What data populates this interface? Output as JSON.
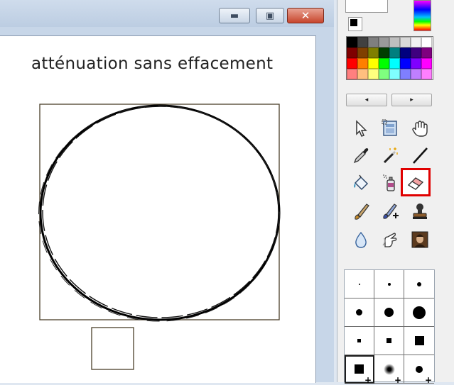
{
  "window": {
    "buttons": {
      "minimize": "minimize-icon",
      "maximize": "maximize-icon",
      "close": "close-icon"
    }
  },
  "canvas": {
    "text": "atténuation sans effacement"
  },
  "palette": {
    "colors": [
      "#000000",
      "#404040",
      "#7f7f7f",
      "#9a9a9a",
      "#bfbfbf",
      "#d9d9d9",
      "#f2f2f2",
      "#ffffff",
      "#7f0000",
      "#7f3f00",
      "#7f7f00",
      "#003f00",
      "#007f7f",
      "#00007f",
      "#3f007f",
      "#7f007f",
      "#ff0000",
      "#ff7f00",
      "#ffff00",
      "#00ff00",
      "#00ffff",
      "#0000ff",
      "#7f00ff",
      "#ff00ff",
      "#ff7f7f",
      "#ffbf7f",
      "#ffff7f",
      "#7fff7f",
      "#7fffff",
      "#7f7fff",
      "#bf7fff",
      "#ff7fff"
    ],
    "nav": {
      "left": "◂",
      "right": "▸"
    }
  },
  "tools": [
    {
      "name": "select-arrow-icon"
    },
    {
      "name": "image-select-icon"
    },
    {
      "name": "hand-pan-icon"
    },
    {
      "name": "color-picker-icon"
    },
    {
      "name": "magic-wand-icon"
    },
    {
      "name": "line-icon"
    },
    {
      "name": "paint-bucket-icon"
    },
    {
      "name": "spray-can-icon"
    },
    {
      "name": "eraser-icon",
      "selected": true
    },
    {
      "name": "brush-icon"
    },
    {
      "name": "brush-plus-icon"
    },
    {
      "name": "stamp-icon"
    },
    {
      "name": "drop-blur-icon"
    },
    {
      "name": "smudge-hand-icon"
    },
    {
      "name": "portrait-clone-icon"
    }
  ],
  "brushes": {
    "plus_label": "+",
    "items": [
      {
        "shape": "round",
        "size": 2
      },
      {
        "shape": "round",
        "size": 4
      },
      {
        "shape": "round",
        "size": 6
      },
      {
        "shape": "round",
        "size": 9
      },
      {
        "shape": "round",
        "size": 13
      },
      {
        "shape": "round",
        "size": 18
      },
      {
        "shape": "square",
        "size": 5
      },
      {
        "shape": "square",
        "size": 7
      },
      {
        "shape": "square",
        "size": 13
      },
      {
        "shape": "square",
        "size": 13,
        "active": true,
        "plus": true
      },
      {
        "shape": "soft",
        "size": 16,
        "plus": true
      },
      {
        "shape": "round",
        "size": 10,
        "plus": true
      }
    ]
  }
}
